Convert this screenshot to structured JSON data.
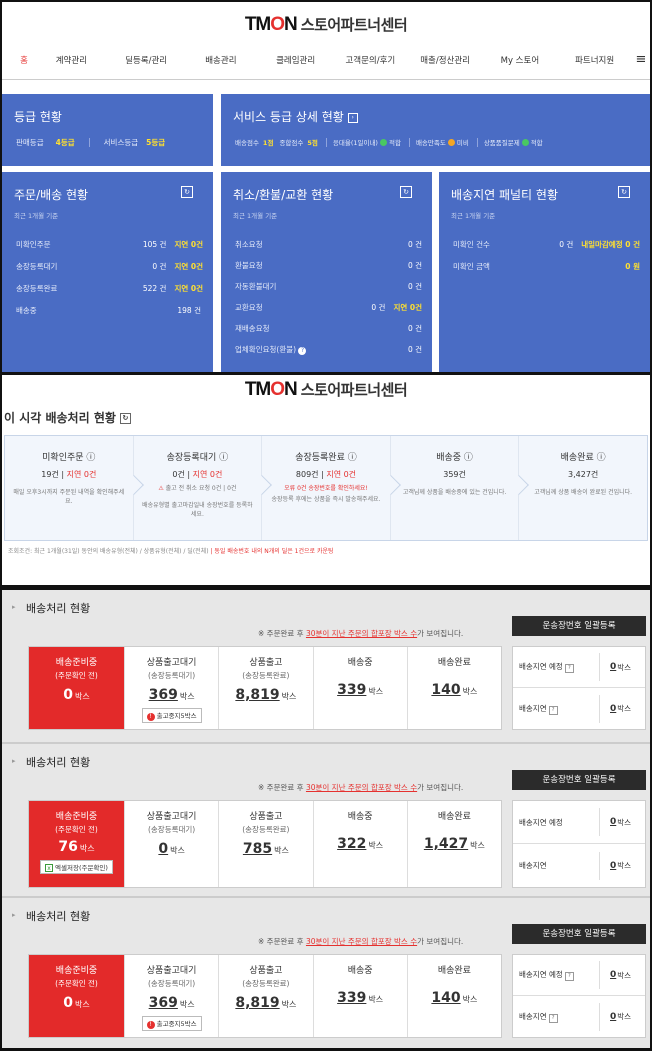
{
  "brand": {
    "logo_pre": "TM",
    "logo_o": "O",
    "logo_post": "N",
    "title": "스토어파트너센터"
  },
  "nav": {
    "items": [
      "홈",
      "계약관리",
      "딜등록/관리",
      "배송관리",
      "클레임관리",
      "고객문의/후기",
      "매출/정산관리",
      "My 스토어",
      "파트너지원"
    ],
    "menu_icon": "≡"
  },
  "grade": {
    "title": "등급 현황",
    "sales_label": "판매등급",
    "sales_value": "4등급",
    "service_label": "서비스등급",
    "service_value": "5등급"
  },
  "service_detail": {
    "title": "서비스 등급 상세 현황",
    "delivery_score_label": "배송점수",
    "delivery_score": "1점",
    "total_score_label": "종합점수",
    "total_score": "5점",
    "reply_label": "응대율(1일이내)",
    "reply_status": "적합",
    "satisfaction_label": "배송만족도",
    "satisfaction_status": "미비",
    "qa_label": "상품품질문제",
    "qa_status": "적합"
  },
  "order_panel": {
    "title": "주문/배송 현황",
    "period": "최근 1개월 기준",
    "rows": [
      {
        "label": "미확인주문",
        "value": "105 건",
        "delay": "지연 0건"
      },
      {
        "label": "송장등록대기",
        "value": "0 건",
        "delay": "지연 0건"
      },
      {
        "label": "송장등록완료",
        "value": "522 건",
        "delay": "지연 0건"
      },
      {
        "label": "배송중",
        "value": "198 건"
      }
    ]
  },
  "claim_panel": {
    "title": "취소/환불/교환 현황",
    "period": "최근 1개월 기준",
    "rows": [
      {
        "label": "취소요청",
        "value": "0 건"
      },
      {
        "label": "환불요청",
        "value": "0 건"
      },
      {
        "label": "자동환불대기",
        "value": "0 건"
      },
      {
        "label": "교환요청",
        "value": "0 건",
        "delay": "지연 0건"
      },
      {
        "label": "재배송요청",
        "value": "0 건"
      },
      {
        "label": "업체확인요청(환불)",
        "value": "0 건"
      }
    ]
  },
  "penalty_panel": {
    "title": "배송지연 패널티 현황",
    "period": "최근 1개월 기준",
    "rows": [
      {
        "label": "미확인 건수",
        "value": "0 건",
        "note": "내일마감예정 0 건"
      },
      {
        "label": "미확인 금액",
        "note": "0 원"
      }
    ]
  },
  "realtime": {
    "title": "이 시각 배송처리 현황",
    "cols": [
      {
        "head": "미확인주문",
        "count": "19건",
        "delay": "지연 0건",
        "desc": "매일 오후3시까지 주문된 내역을 확인해주세요."
      },
      {
        "head": "송장등록대기",
        "count": "0건",
        "delay": "지연 0건",
        "note": "출고 전 취소 요청 0건 | 0건",
        "desc": "배송유형별 출고마감일내 송장번호를 등록하세요."
      },
      {
        "head": "송장등록완료",
        "count": "809건",
        "delay": "지연 0건",
        "note": "오류 0건 송장번호를 확인하세요!",
        "desc": "송장등록 후에는 상품을 즉시 발송해주세요."
      },
      {
        "head": "배송중",
        "count": "359건",
        "desc": "고객님께 상품을 배송중에 있는 건입니다."
      },
      {
        "head": "배송완료",
        "count": "3,427건",
        "desc": "고객님께 상품 배송이 완료된 건입니다."
      }
    ],
    "footer_pre": "조회조건: 최근 1개월(31일) 동안의 배송유형(전체) / 상품유형(전체) / 딜(전체)",
    "footer_red": "| 동일 배송번호 내의 N개의 딜은 1건으로 카운팅"
  },
  "blocks": [
    {
      "title": "배송처리 현황",
      "notice_pre": "※ 주문완료 후",
      "notice_link": "30분이 지난 주문의 합포장 박스 수",
      "notice_post": "가 보여집니다.",
      "button": "운송장번호 일괄등록",
      "cards": [
        {
          "t": "배송준비중",
          "s": "(주문확인 전)",
          "n": "0",
          "u": "박스"
        },
        {
          "t": "상품출고대기",
          "s": "(송장등록대기)",
          "n": "369",
          "u": "박스",
          "badge": "출고중지5박스"
        },
        {
          "t": "상품출고",
          "s": "(송장등록완료)",
          "n": "8,819",
          "u": "박스"
        },
        {
          "t": "배송중",
          "n": "339",
          "u": "박스"
        },
        {
          "t": "배송완료",
          "n": "140",
          "u": "박스"
        }
      ],
      "side": [
        {
          "label": "배송지연 예정",
          "n": "0",
          "u": "박스"
        },
        {
          "label": "배송지연",
          "n": "0",
          "u": "박스"
        }
      ]
    },
    {
      "title": "배송처리 현황",
      "notice_pre": "※ 주문완료 후",
      "notice_link": "30분이 지난 주문의 합포장 박스 수",
      "notice_post": "가 보여집니다.",
      "button": "운송장번호 일괄등록",
      "cards": [
        {
          "t": "배송준비중",
          "s": "(주문확인 전)",
          "n": "76",
          "u": "박스",
          "badge": "엑셀저장(주문확인)"
        },
        {
          "t": "상품출고대기",
          "s": "(송장등록대기)",
          "n": "0",
          "u": "박스"
        },
        {
          "t": "상품출고",
          "s": "(송장등록완료)",
          "n": "785",
          "u": "박스"
        },
        {
          "t": "배송중",
          "n": "322",
          "u": "박스"
        },
        {
          "t": "배송완료",
          "n": "1,427",
          "u": "박스"
        }
      ],
      "side": [
        {
          "label": "배송지연 예정",
          "n": "0",
          "u": "박스"
        },
        {
          "label": "배송지연",
          "n": "0",
          "u": "박스"
        }
      ]
    },
    {
      "title": "배송처리 현황",
      "notice_pre": "※ 주문완료 후",
      "notice_link": "30분이 지난 주문의 합포장 박스 수",
      "notice_post": "가 보여집니다.",
      "button": "운송장번호 일괄등록",
      "cards": [
        {
          "t": "배송준비중",
          "s": "(주문확인 전)",
          "n": "0",
          "u": "박스"
        },
        {
          "t": "상품출고대기",
          "s": "(송장등록대기)",
          "n": "369",
          "u": "박스",
          "badge": "출고중지5박스"
        },
        {
          "t": "상품출고",
          "s": "(송장등록완료)",
          "n": "8,819",
          "u": "박스"
        },
        {
          "t": "배송중",
          "n": "339",
          "u": "박스"
        },
        {
          "t": "배송완료",
          "n": "140",
          "u": "박스"
        }
      ],
      "side": [
        {
          "label": "배송지연 예정",
          "n": "0",
          "u": "박스"
        },
        {
          "label": "배송지연",
          "n": "0",
          "u": "박스"
        }
      ]
    }
  ]
}
